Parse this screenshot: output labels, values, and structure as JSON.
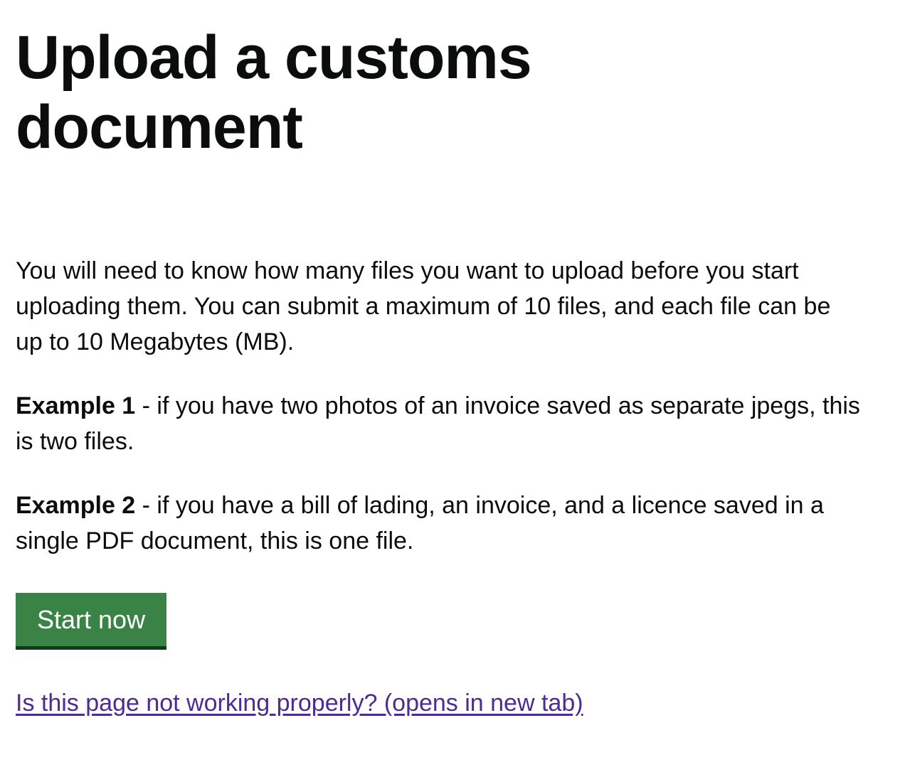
{
  "page": {
    "title": "Upload a customs document",
    "intro": "You will need to know how many files you want to upload before you start uploading them. You can submit a maximum of 10 files, and each file can be up to 10 Megabytes (MB).",
    "examples": [
      {
        "label": "Example 1",
        "text": " - if you have two photos of an invoice saved as separate jpegs, this is two files."
      },
      {
        "label": "Example 2",
        "text": " - if you have a bill of lading, an invoice, and a licence saved in a single PDF document, this is one file."
      }
    ],
    "start_button_label": "Start now",
    "help_link_label": "Is this page not working properly? (opens in new tab)"
  },
  "colors": {
    "button_background": "#3a8246",
    "button_shadow": "#0b3b1c",
    "link": "#4c2c92",
    "text": "#0b0c0c"
  }
}
